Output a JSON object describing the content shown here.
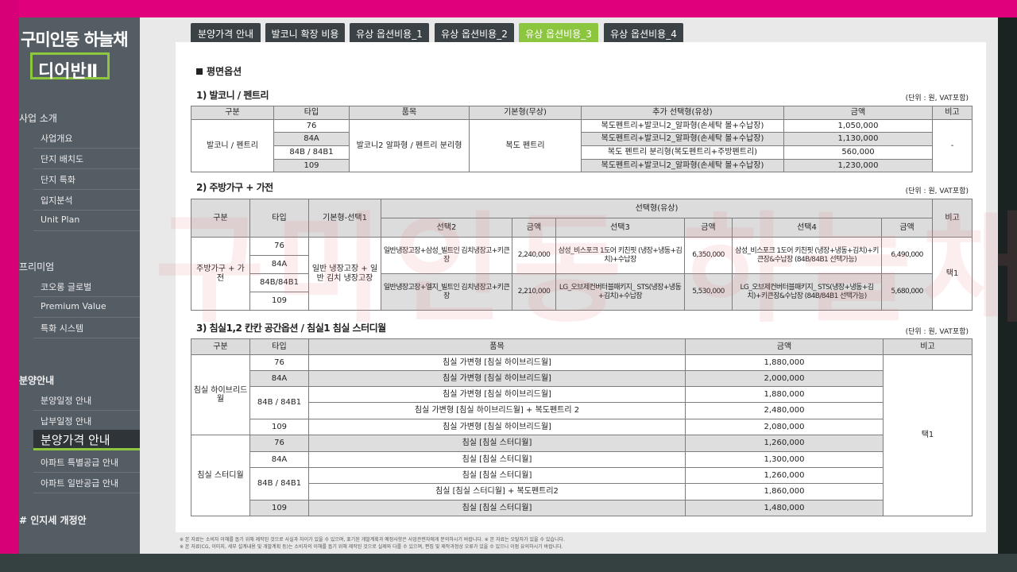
{
  "brand": {
    "title": "구미인동 하늘채",
    "logo": "디어반Ⅱ"
  },
  "sidebar": {
    "sections": [
      {
        "label": "사업 소개",
        "items": [
          "사업개요",
          "단지 배치도",
          "단지 특화",
          "입지분석",
          "Unit Plan"
        ]
      },
      {
        "label": "프리미엄",
        "items": [
          "코오롱 글로벌",
          "Premium Value",
          "특화 시스템"
        ]
      },
      {
        "label": "분양안내",
        "items": [
          "분양일정 안내",
          "납부일정 안내",
          "분양가격 안내",
          "아파트 특별공급 안내",
          "아파트 일반공급 안내"
        ]
      },
      {
        "label": "# 인지세 개정안",
        "items": []
      }
    ],
    "active_item": "분양가격 안내"
  },
  "tabs": [
    "분양가격 안내",
    "발코니 확장 비용",
    "유상 옵션비용_1",
    "유상 옵션비용_2",
    "유상 옵션비용_3",
    "유상 옵션비용_4"
  ],
  "active_tab": "유상 옵션비용_3",
  "page": {
    "heading": "평면옵션",
    "unit_note": "(단위 : 원, VAT포함)",
    "watermark": "구미인동 하늘채 디어반2차",
    "footnotes": [
      "※ 본 자료는 소비자 이해를 돕기 위해 제작된 것으로 사실과 차이가 있을 수 있으며, 표기된 개발계획과 예정사항은 사업관련자에게 문의하시기 바랍니다.   ※ 본 자료는 오탈자가 있을 수 있습니다.",
      "※ 본 자료(CG, 이미지, 세부 설계내용 및 개발계획 등)는 소비자의 이해를 돕기 위해 제작된 것으로 실제와 다를 수 있으며, 편집 및 제작과정상 오류가 있을 수 있으니 이점 유의하시기 바랍니다."
    ]
  },
  "table1": {
    "title": "1) 발코니 / 펜트리",
    "headers": [
      "구분",
      "타입",
      "품목",
      "기본형(무상)",
      "추가 선택형(유상)",
      "금액",
      "비고"
    ],
    "category": "발코니 / 펜트리",
    "item": "발코니2 알파형 / 펜트리 분리형",
    "basic": "복도 펜트리",
    "note": "-",
    "rows": [
      {
        "type": "76",
        "option": "복도펜트리+발코니2_알파형(손세탁 볼+수납장)",
        "price": "1,050,000"
      },
      {
        "type": "84A",
        "option": "복도펜트리+발코니2_알파형(손세탁 볼+수납장)",
        "price": "1,130,000"
      },
      {
        "type": "84B / 84B1",
        "option": "복도 펜트리 분리형(복도펜트리+주방펜트리)",
        "price": "560,000"
      },
      {
        "type": "109",
        "option": "복도펜트리+발코니2_알파형(손세탁 볼+수납장)",
        "price": "1,230,000"
      }
    ]
  },
  "table2": {
    "title": "2) 주방가구 + 가전",
    "headers": {
      "category": "구분",
      "type": "타입",
      "basic": "기본형-선택1",
      "optional": "선택형(유상)",
      "sel2": "선택2",
      "price": "금액",
      "sel3": "선택3",
      "sel4": "선택4",
      "note": "비고"
    },
    "category": "주방가구 + 가전",
    "types": [
      "76",
      "84A",
      "84B/84B1",
      "109"
    ],
    "basic": "일반 냉장고장 + 일반 김치 냉장고장",
    "note": "택1",
    "rows": [
      {
        "sel2": "일반냉장고장+삼성_빌트인 김치냉장고+키큰장",
        "p2": "2,240,000",
        "sel3": "삼성_비스포크 1도어 키친핏 (냉장+냉동+김치)+수납장",
        "p3": "6,350,000",
        "sel4": "삼성_비스포크 1도어 키친핏 (냉장+냉동+김치)+키큰장&수납장 (84B/84B1 선택가능)",
        "p4": "6,490,000"
      },
      {
        "sel2": "일반냉장고장+엘지_빌트인 김치냉장고+키큰장",
        "p2": "2,210,000",
        "sel3": "LG_오브제컨버터블패키지_ STS(냉장+냉동+김치)+수납장",
        "p3": "5,530,000",
        "sel4": "LG_오브제컨버터블패키지_ STS(냉장+냉동+김치)+키큰장&수납장 (84B/84B1 선택가능)",
        "p4": "5,680,000"
      }
    ]
  },
  "table3": {
    "title": "3) 침실1,2 칸칸 공간옵션 / 침실1 침실 스터디월",
    "headers": [
      "구분",
      "타입",
      "품목",
      "금액",
      "비고"
    ],
    "note": "택1",
    "groups": [
      {
        "category": "침실 하이브리드월",
        "rows": [
          {
            "type": "76",
            "item": "침실 가변형 [침실 하이브리드월]",
            "price": "1,880,000"
          },
          {
            "type": "84A",
            "item": "침실 가변형 [침실 하이브리드월]",
            "price": "2,000,000"
          },
          {
            "type": "84B / 84B1",
            "item": "침실 가변형 [침실 하이브리드월]",
            "price": "1,880,000"
          },
          {
            "type": "",
            "item": "침실 가변형 [침실 하이브리드월] + 복도펜트리 2",
            "price": "2,480,000"
          },
          {
            "type": "109",
            "item": "침실 가변형 [침실 하이브리드월]",
            "price": "2,080,000"
          }
        ]
      },
      {
        "category": "침실 스터디월",
        "rows": [
          {
            "type": "76",
            "item": "침실 [침실 스터디월]",
            "price": "1,260,000"
          },
          {
            "type": "84A",
            "item": "침실 [침실 스터디월]",
            "price": "1,300,000"
          },
          {
            "type": "84B / 84B1",
            "item": "침실 [침실 스터디월]",
            "price": "1,260,000"
          },
          {
            "type": "",
            "item": "침실 [침실 스터디월] + 복도펜트리2",
            "price": "1,860,000"
          },
          {
            "type": "109",
            "item": "침실 [침실 스터디월]",
            "price": "1,480,000"
          }
        ]
      }
    ]
  },
  "colors": {
    "accent": "#8cc63f",
    "frame": "#e0007b",
    "sidebar": "#545c64",
    "tab": "#3b4246"
  }
}
